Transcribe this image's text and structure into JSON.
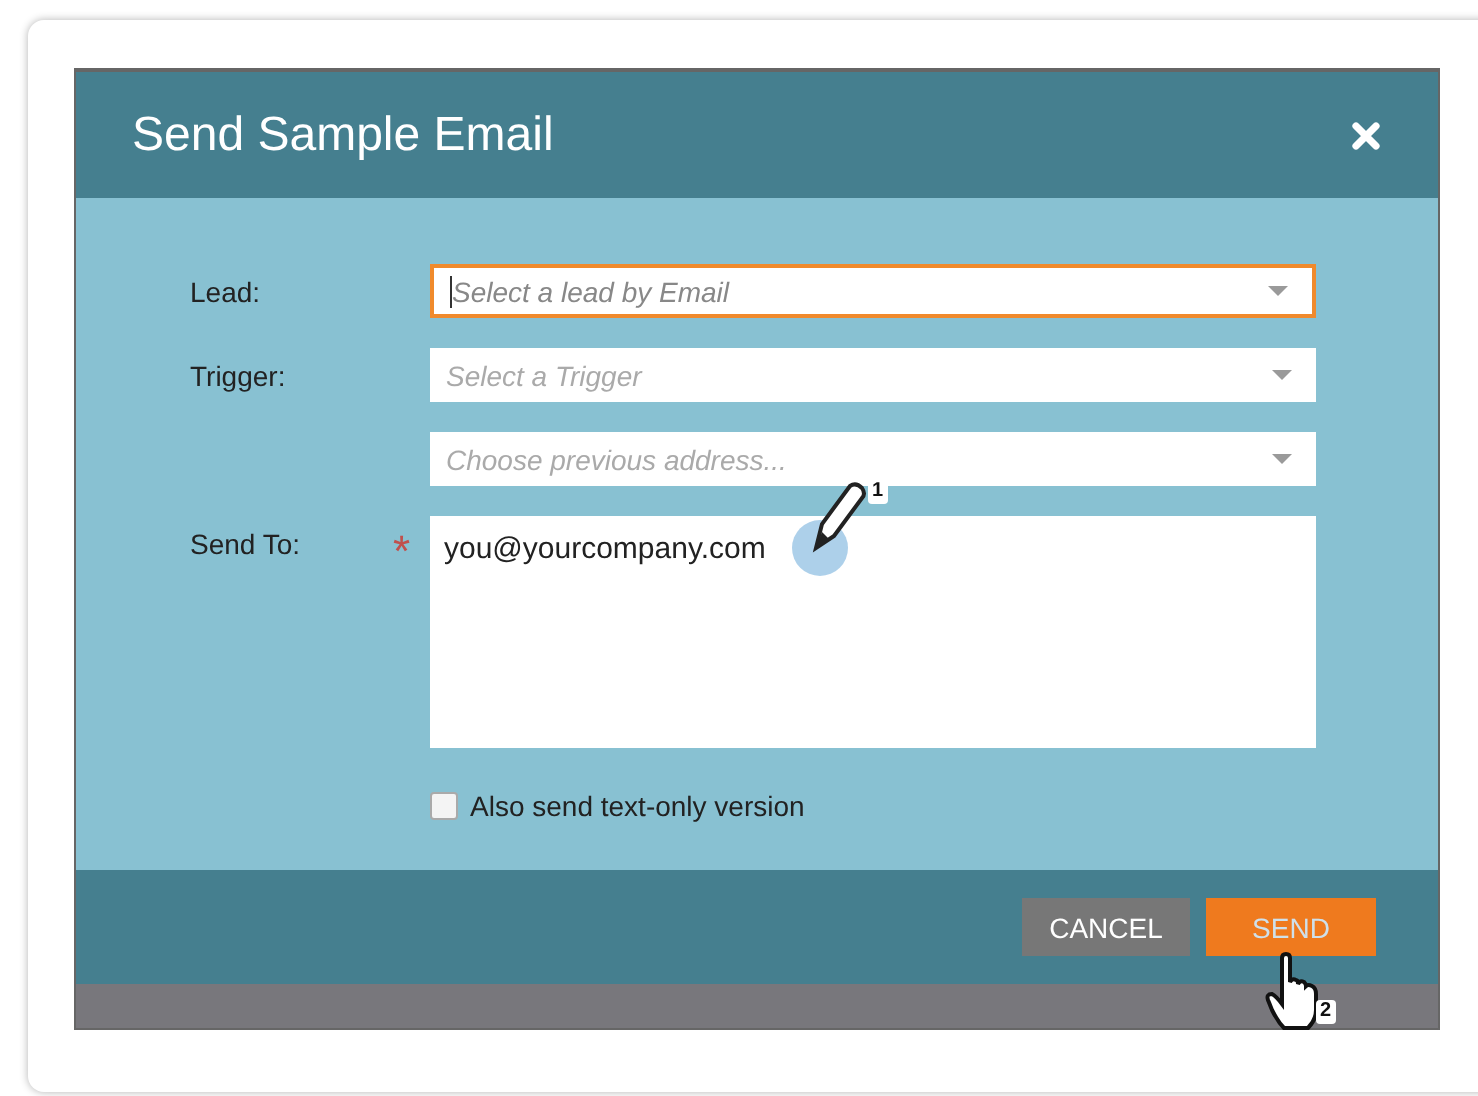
{
  "dialog": {
    "title": "Send Sample Email"
  },
  "fields": [
    {
      "kind": "select",
      "label": "Lead:",
      "placeholder": "Select a lead by Email",
      "focused": true
    },
    {
      "kind": "select",
      "label": "Trigger:",
      "placeholder": "Select a Trigger",
      "focused": false
    },
    {
      "kind": "select",
      "placeholder": "Choose previous address...",
      "focused": false
    },
    {
      "kind": "textarea",
      "label": "Send To:",
      "required": "*",
      "value": "you@yourcompany.com",
      "focused": false
    }
  ],
  "checkbox": {
    "label": "Also send text-only version",
    "checked": false
  },
  "buttons": [
    {
      "kind": "secondary",
      "label": "CANCEL"
    },
    {
      "kind": "primary",
      "label": "SEND"
    }
  ],
  "callouts": [
    {
      "kind": "pencil",
      "number": "1"
    },
    {
      "kind": "hand",
      "number": "2"
    }
  ]
}
